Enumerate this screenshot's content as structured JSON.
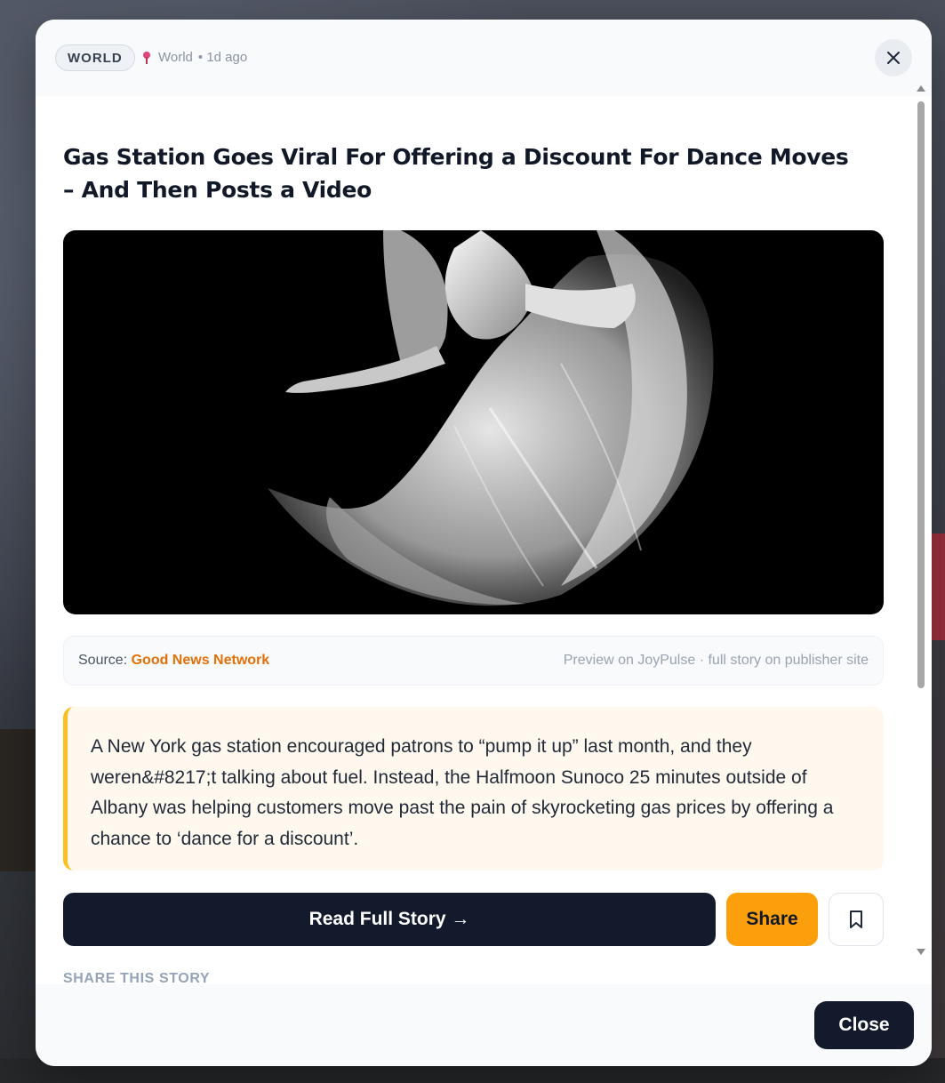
{
  "header": {
    "category_badge": "WORLD",
    "location": "World",
    "age": "• 1d ago"
  },
  "article": {
    "title": "Gas Station Goes Viral For Offering a Discount For Dance Moves – And Then Posts a Video",
    "source_label": "Source:",
    "source_name": "Good News Network",
    "preview_note": "Preview on JoyPulse · full story on publisher site",
    "excerpt": "A New York gas station encouraged patrons to “pump it up” last month, and they weren&#8217;t talking about fuel. Instead, the Halfmoon Sunoco 25 minutes outside of Albany was helping customers move past the pain of skyrocketing gas prices by offering a chance to ‘dance for a discount’."
  },
  "actions": {
    "read_full_story": "Read Full Story →",
    "share": "Share"
  },
  "share_section": {
    "heading": "SHARE THIS STORY"
  },
  "footer": {
    "close": "Close"
  },
  "icons": [
    "pin-icon",
    "close-icon",
    "bookmark-icon"
  ],
  "colors": {
    "accent_orange": "#fb9f0c",
    "source_orange": "#e36f08",
    "dark_button": "#121a2c",
    "excerpt_border": "#fbbf24",
    "excerpt_bg": "#fff8ee"
  }
}
